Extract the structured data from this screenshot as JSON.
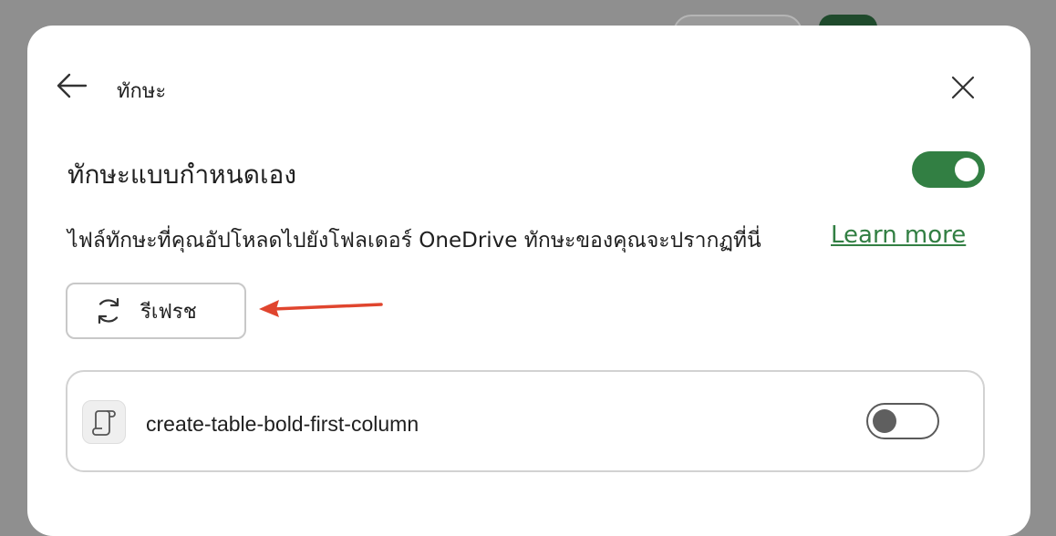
{
  "header": {
    "title": "ทักษะ"
  },
  "custom_skills": {
    "title": "ทักษะแบบกำหนดเอง",
    "enabled": true,
    "description": "ไฟล์ทักษะที่คุณอัปโหลดไปยังโฟลเดอร์ OneDrive ทักษะของคุณจะปรากฏที่นี่",
    "learn_more_label": "Learn more",
    "refresh_label": "รีเฟรช"
  },
  "skills": [
    {
      "name": "create-table-bold-first-column",
      "enabled": false
    }
  ],
  "colors": {
    "accent": "#327f43",
    "annotation_arrow": "#e0452e"
  },
  "icons": {
    "back": "arrow-left-icon",
    "close": "close-icon",
    "refresh": "refresh-icon",
    "skill": "script-icon"
  }
}
